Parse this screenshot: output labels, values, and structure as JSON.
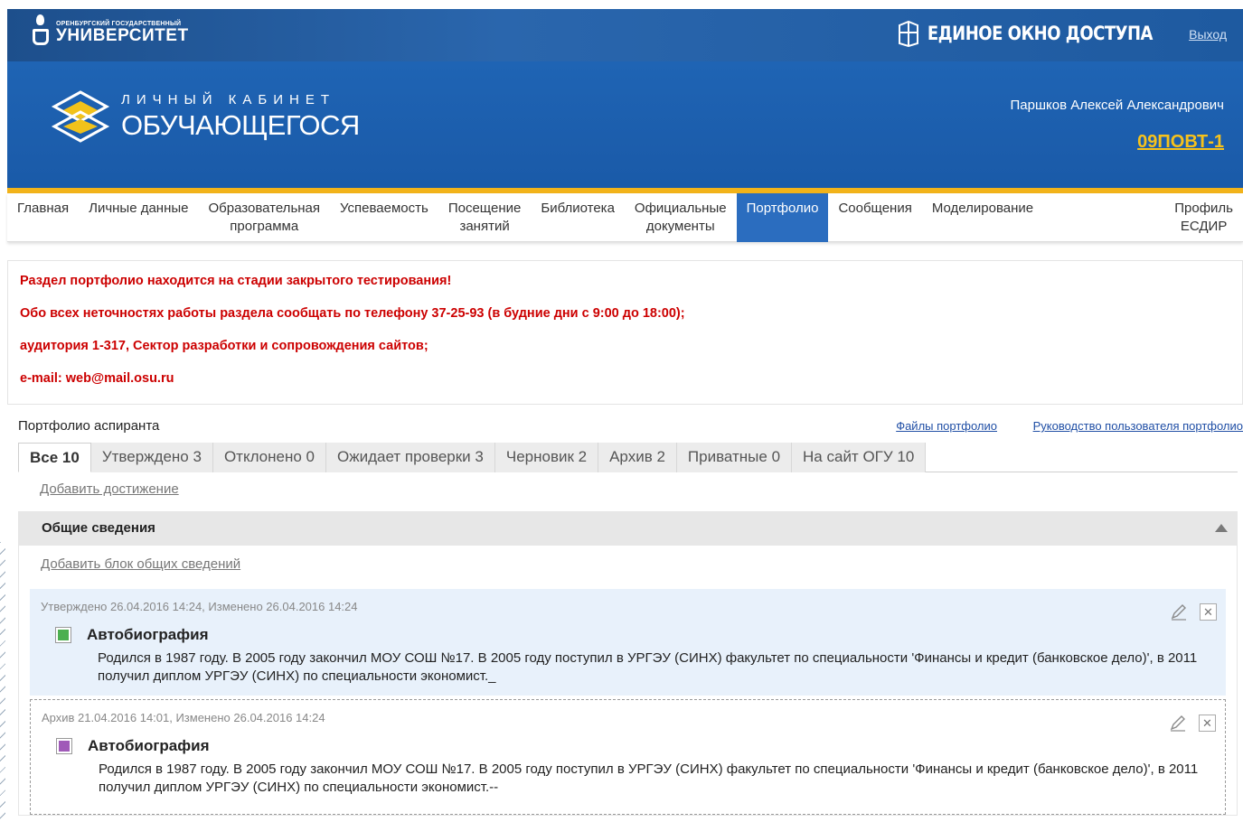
{
  "header": {
    "university_small": "ОРЕНБУРГСКИЙ ГОСУДАРСТВЕННЫЙ",
    "university_big": "УНИВЕРСИТЕТ",
    "single_window": "ЕДИНОЕ ОКНО ДОСТУПА",
    "logout": "Выход",
    "cabinet_top": "ЛИЧНЫЙ КАБИНЕТ",
    "cabinet_bottom": "ОБУЧАЮЩЕГОСЯ",
    "user_name": "Паршков Алексей Александрович",
    "group": "09ПОВТ-1"
  },
  "nav": {
    "items": [
      {
        "label": "Главная"
      },
      {
        "label": "Личные данные"
      },
      {
        "label": "Образовательная\nпрограмма"
      },
      {
        "label": "Успеваемость"
      },
      {
        "label": "Посещение\nзанятий"
      },
      {
        "label": "Библиотека"
      },
      {
        "label": "Официальные\nдокументы"
      },
      {
        "label": "Портфолио"
      },
      {
        "label": "Сообщения"
      },
      {
        "label": "Моделирование"
      }
    ],
    "active_label": "Портфолио",
    "right_item": "Профиль\nЕСДИР"
  },
  "notice": {
    "lines": [
      "Раздел портфолио находится на стадии закрытого тестирования!",
      "Обо всех неточностях работы раздела сообщать по телефону 37-25-93 (в будние дни с 9:00 до 18:00);",
      "аудитория 1-317, Сектор разработки и сопровождения сайтов;",
      "e-mail: web@mail.osu.ru"
    ]
  },
  "portfolio": {
    "title": "Портфолио аспиранта",
    "files_link": "Файлы портфолио",
    "guide_link": "Руководство пользователя портфолио",
    "tabs": [
      {
        "label": "Все 10"
      },
      {
        "label": "Утверждено 3"
      },
      {
        "label": "Отклонено 0"
      },
      {
        "label": "Ожидает проверки 3"
      },
      {
        "label": "Черновик 2"
      },
      {
        "label": "Архив 2"
      },
      {
        "label": "Приватные 0"
      },
      {
        "label": "На сайт ОГУ 10"
      }
    ],
    "add_achievement": "Добавить достижение"
  },
  "section": {
    "title": "Общие сведения",
    "add_block": "Добавить блок общих сведений",
    "items": [
      {
        "meta": "Утверждено 26.04.2016 14:24, Изменено 26.04.2016 14:24",
        "title": "Автобиография",
        "text": "Родился в 1987 году. В 2005 году закончил МОУ СОШ №17. В 2005 году поступил в УРГЭУ (СИНХ) факультет по специальности 'Финансы и кредит (банковское дело)', в 2011 получил диплом УРГЭУ (СИНХ) по специальности экономист._",
        "color": "#4caf50"
      },
      {
        "meta": "Архив 21.04.2016 14:01, Изменено 26.04.2016 14:24",
        "title": "Автобиография",
        "text": "Родился в 1987 году. В 2005 году закончил МОУ СОШ №17. В 2005 году поступил в УРГЭУ (СИНХ) факультет по специальности 'Финансы и кредит (банковское дело)', в 2011 получил диплом УРГЭУ (СИНХ) по специальности экономист.--",
        "color": "#a05ab8"
      }
    ]
  },
  "colors": {
    "header_blue": "#1f64b4",
    "accent_yellow": "#f2b31a",
    "active_tab": "#2b6dbf",
    "notice_red": "#cc0000"
  }
}
